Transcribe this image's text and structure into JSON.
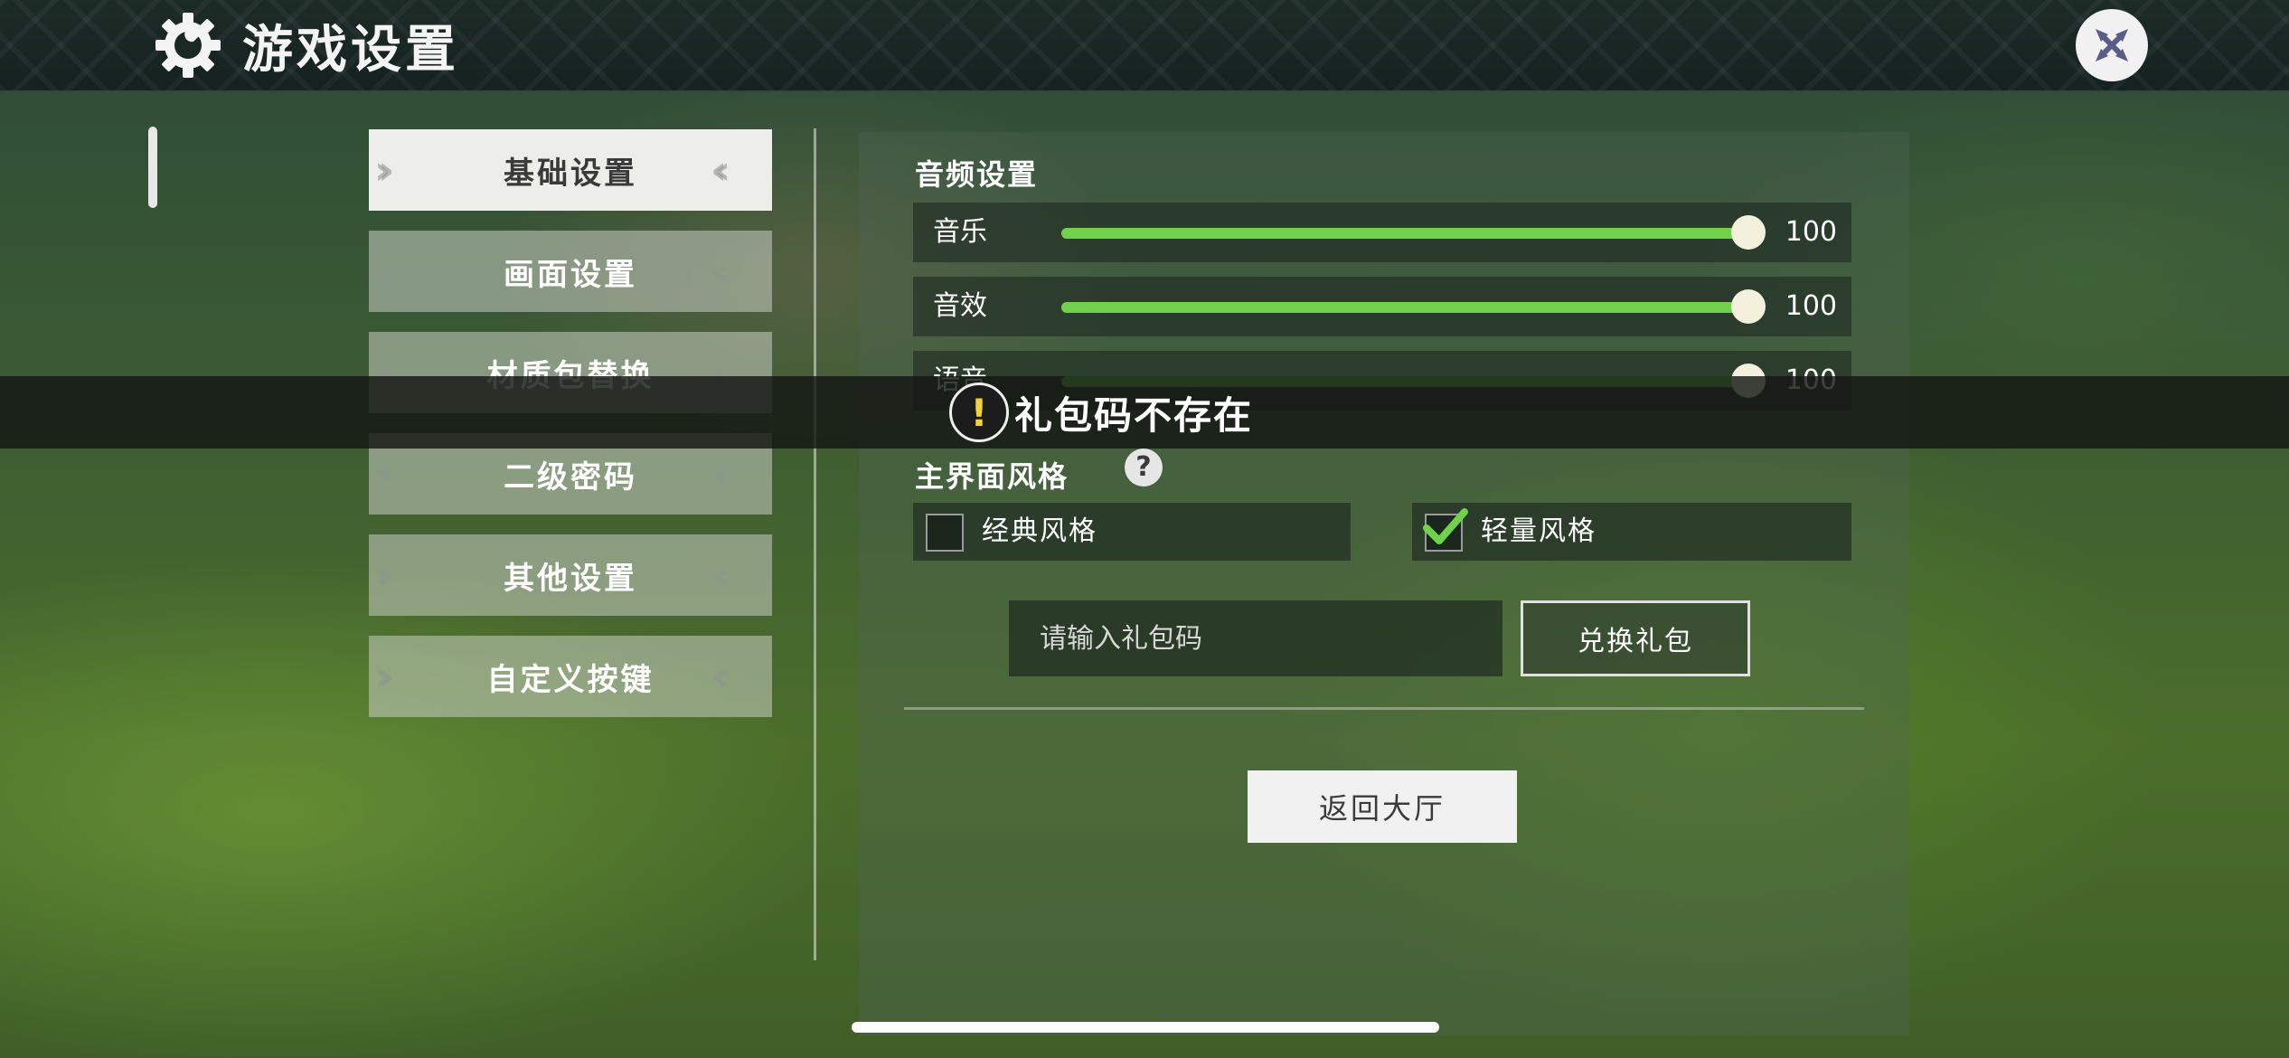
{
  "header": {
    "title": "游戏设置",
    "settings_icon": "gear-wrench-icon",
    "close_icon": "close-x-icon"
  },
  "sidebar": {
    "items": [
      {
        "label": "基础设置",
        "active": true
      },
      {
        "label": "画面设置",
        "active": false
      },
      {
        "label": "材质包替换",
        "active": false
      },
      {
        "label": "二级密码",
        "active": false
      },
      {
        "label": "其他设置",
        "active": false
      },
      {
        "label": "自定义按键",
        "active": false
      }
    ]
  },
  "audio": {
    "section_title": "音频设置",
    "sliders": [
      {
        "label": "音乐",
        "value": "100",
        "level": 100
      },
      {
        "label": "音效",
        "value": "100",
        "level": 100
      },
      {
        "label": "语音",
        "value": "100",
        "level": 100
      }
    ]
  },
  "style": {
    "section_title": "主界面风格",
    "help_glyph": "?",
    "options": [
      {
        "label": "经典风格",
        "checked": false
      },
      {
        "label": "轻量风格",
        "checked": true
      }
    ]
  },
  "gift": {
    "placeholder": "请输入礼包码",
    "redeem_label": "兑换礼包"
  },
  "return_label": "返回大厅",
  "toast": {
    "text": "礼包码不存在",
    "icon": "exclamation-icon",
    "glyph": "!"
  },
  "colors": {
    "slider_fill": "#6fd24a",
    "check_green": "#6fd24a",
    "warning_yellow": "#f1d23b"
  }
}
